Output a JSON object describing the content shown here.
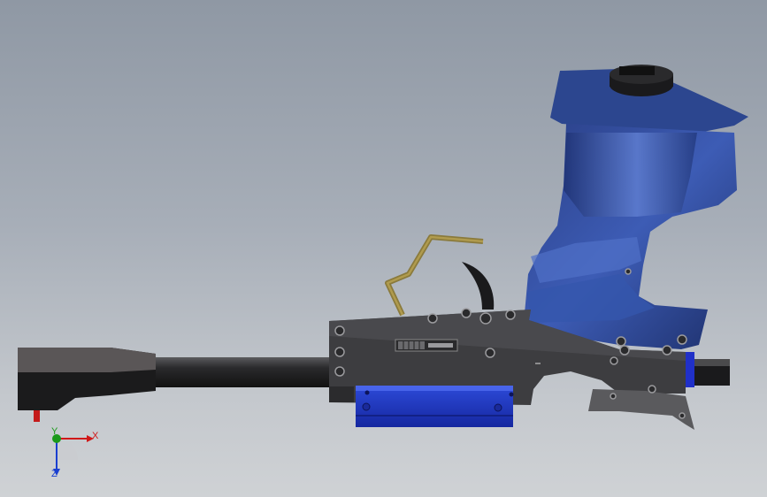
{
  "viewport": {
    "background_top": "#8f98a4",
    "background_bottom": "#cfd2d5"
  },
  "model": {
    "grip_color": "#2d4a9a",
    "rail_color": "#1f3ac4",
    "frame_color": "#3f3f42",
    "barrel_color": "#1c1c1e",
    "trigger_guard_color": "#8a7a3c",
    "muzzle_color": "#4a4a4c"
  },
  "triad": {
    "x_label": "X",
    "y_label": "Y",
    "z_label": "Z",
    "x_color": "#d01818",
    "y_color": "#1a9a1a",
    "z_color": "#1a3fd0"
  }
}
